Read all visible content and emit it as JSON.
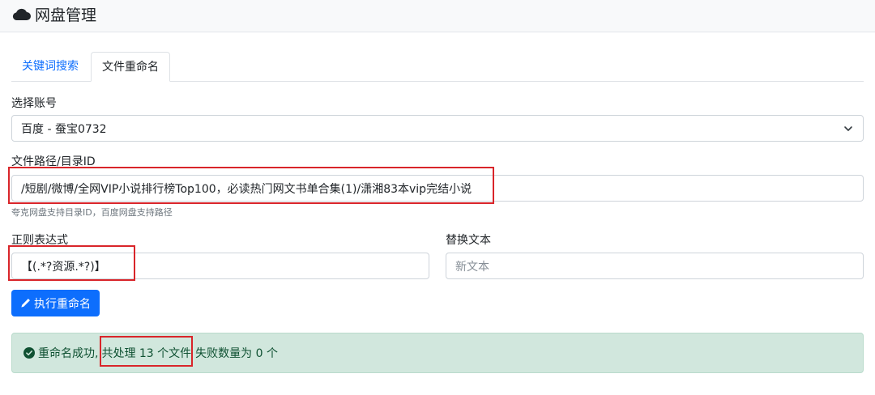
{
  "header": {
    "title": "网盘管理",
    "icon": "cloud-icon"
  },
  "tabs": [
    {
      "label": "关键词搜索",
      "active": false
    },
    {
      "label": "文件重命名",
      "active": true
    }
  ],
  "form": {
    "account": {
      "label": "选择账号",
      "value": "百度 - 蚕宝0732"
    },
    "path": {
      "label": "文件路径/目录ID",
      "value": "/短剧/微博/全网VIP小说排行榜Top100，必读热门网文书单合集(1)/潇湘83本vip完结小说",
      "help": "夸克网盘支持目录ID，百度网盘支持路径"
    },
    "regex": {
      "label": "正则表达式",
      "value": "【(.*?资源.*?)】"
    },
    "replace": {
      "label": "替换文本",
      "placeholder": "新文本"
    },
    "submit_label": "执行重命名"
  },
  "alert": {
    "prefix": "重命名成功,",
    "processed": "共处理 13 个文件",
    "suffix": "失败数量为 0 个"
  },
  "colors": {
    "primary": "#0d6efd",
    "success_bg": "#d1e7dd",
    "success_text": "#0f5132",
    "annotation": "#d9252a"
  }
}
